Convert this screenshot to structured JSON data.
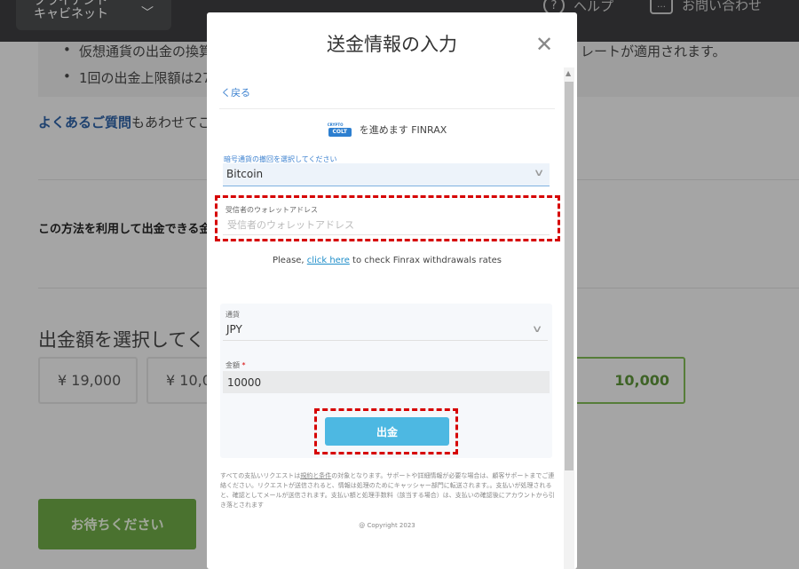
{
  "header": {
    "account_line1": "クライアント",
    "account_line2": "キャビネット",
    "help_label": "ヘルプ",
    "contact_label": "お問い合わせ"
  },
  "background": {
    "notice_line1": "仮想通貨の出金の換算",
    "notice_line1_end": "レートが適用されます。",
    "notice_line2": "1回の出金上限額は27,",
    "faq_link": "よくあるご質問",
    "faq_rest": "もあわせてご",
    "method_label": "この方法を利用して出金できる金",
    "amount_title": "出金額を選択してく",
    "amounts": [
      "¥ 19,000",
      "¥ 10,0",
      "10,000"
    ],
    "wait_button": "お待ちください"
  },
  "modal": {
    "title": "送金情報の入力",
    "back_label": "く戻る",
    "provider_text": "を進めます FINRAX",
    "logo_top": "CRYPTO",
    "logo_text": "COLT",
    "currency_select_label": "暗号通貨の撤回を選択してください",
    "currency_value": "Bitcoin",
    "wallet_label": "受信者のウォレットアドレス",
    "wallet_placeholder": "受信者のウォレットアドレス",
    "rates_prefix": "Please, ",
    "rates_link": "click here",
    "rates_suffix": " to check Finrax withdrawals rates",
    "fiat_label": "通貨",
    "fiat_value": "JPY",
    "amount_label": "金額",
    "amount_required": "*",
    "amount_value": "10000",
    "submit_label": "出金",
    "disclaimer_a": "すべての支払いリクエストは",
    "disclaimer_terms": "規約と条件",
    "disclaimer_b": "の対象となります。サポートや詳細情報が必要な場合は、顧客サポートまでご連絡ください。リクエストが送信されると、情報は処理のためにキャッシャー部門に転送されます。。支払いが処理されると、確認としてメールが送信されます。支払い額と処理手数料（該当する場合）は、支払いの確認後にアカウントから引き落とされます",
    "copyright": "@ Copyright 2023"
  },
  "colors": {
    "overlay": "rgba(0,0,0,0.30)",
    "highlight_dash": "#d60000",
    "submit_button": "#4db8e2",
    "link": "#1f8ec9",
    "green_button": "#6aa444"
  }
}
